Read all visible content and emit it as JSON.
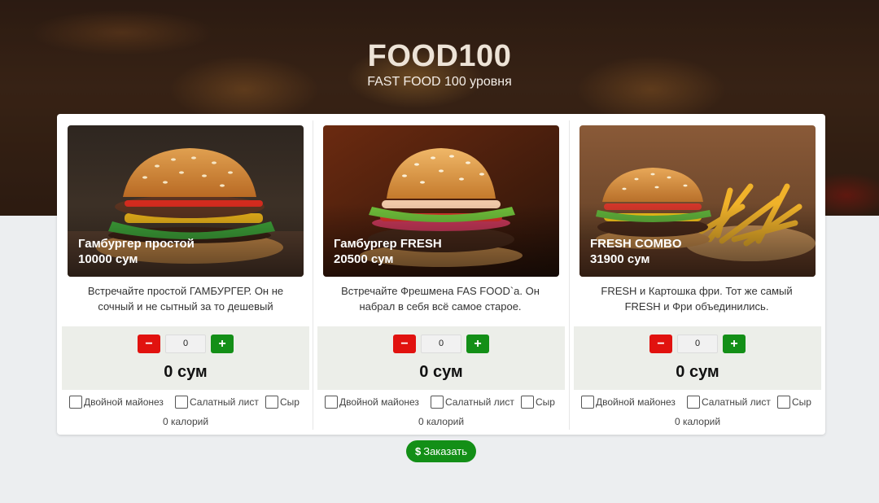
{
  "header": {
    "brand": "FOOD100",
    "tagline": "FAST FOOD 100 уровня"
  },
  "products": [
    {
      "name": "Гамбургер простой",
      "price": "10000 сум",
      "description_lines": [
        "Встречайте простой ГАМБУРГЕР. Он не",
        "сочный и не сытный за то дешевый"
      ],
      "minus_label": "−",
      "quantity": "0",
      "plus_label": "+",
      "total": "0 сум",
      "options": [
        "Двойной майонез",
        "Салатный лист",
        "Сыр"
      ],
      "calories": "0 калорий"
    },
    {
      "name": "Гамбургер FRESH",
      "price": "20500 сум",
      "description_lines": [
        "Встречайте Фрешмена FAS FOOD`а. Он",
        "набрал в себя всё самое старое."
      ],
      "minus_label": "−",
      "quantity": "0",
      "plus_label": "+",
      "total": "0 сум",
      "options": [
        "Двойной майонез",
        "Салатный лист",
        "Сыр"
      ],
      "calories": "0 калорий"
    },
    {
      "name": "FRESH COMBO",
      "price": "31900 сум",
      "description_lines": [
        "FRESH и Картошка фри. Тот же самый",
        "FRESH и Фри объединились."
      ],
      "minus_label": "−",
      "quantity": "0",
      "plus_label": "+",
      "total": "0 сум",
      "options": [
        "Двойной майонез",
        "Салатный лист",
        "Сыр"
      ],
      "calories": "0 калорий"
    }
  ],
  "order_button": {
    "icon": "$",
    "label": "Заказать"
  },
  "colors": {
    "minus": "#e1120f",
    "plus": "#138f17",
    "order": "#138f17"
  }
}
